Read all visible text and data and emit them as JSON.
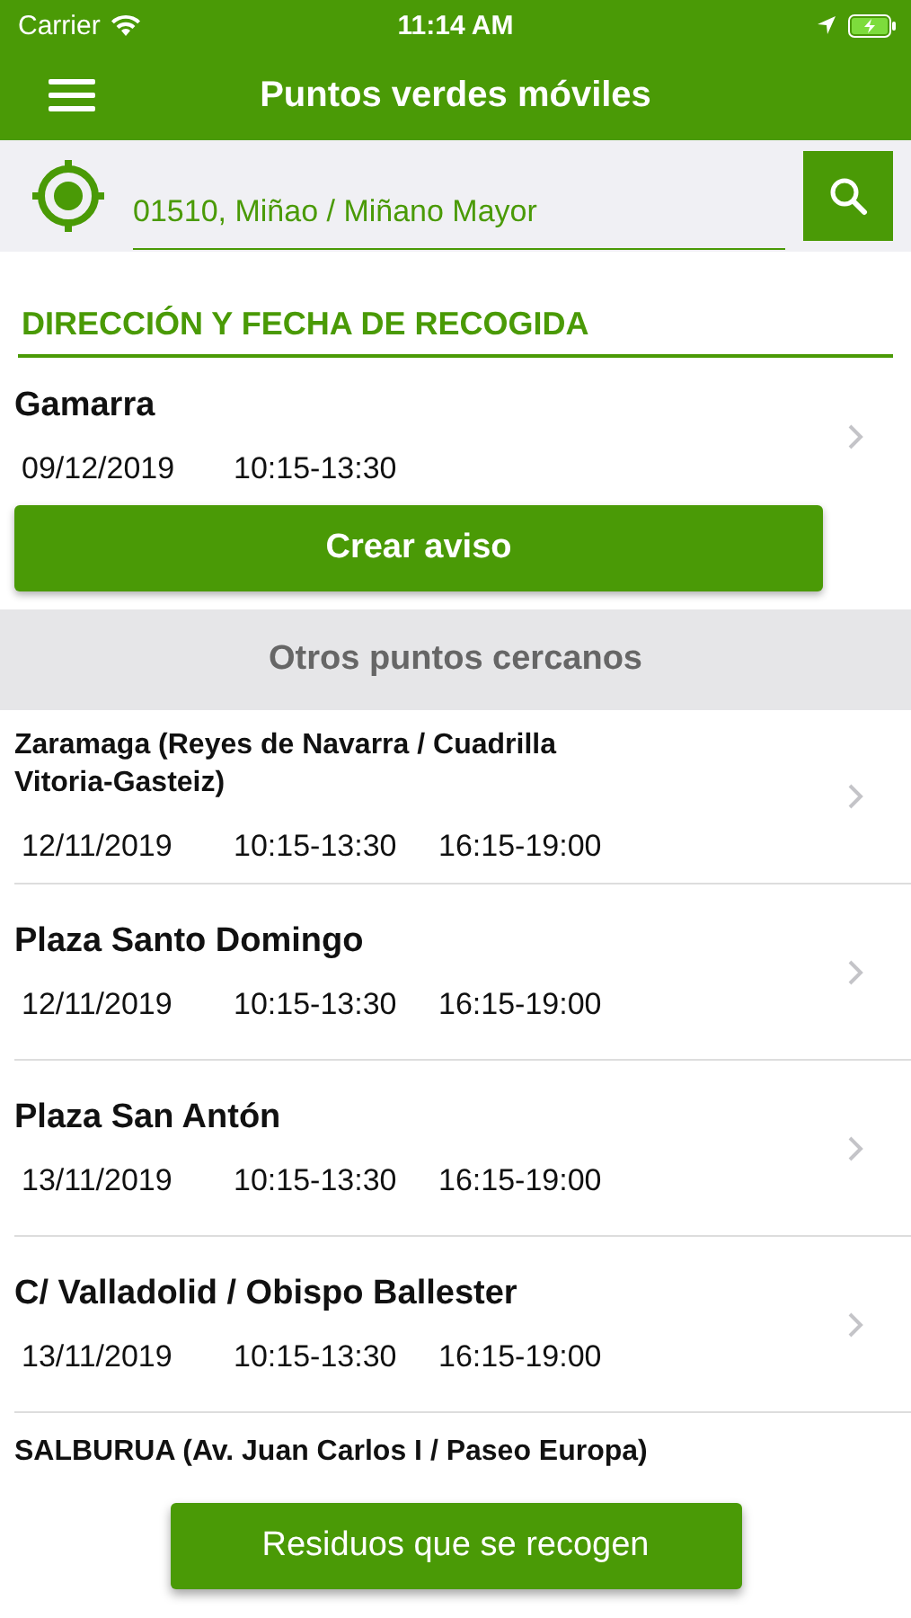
{
  "status_bar": {
    "carrier": "Carrier",
    "time": "11:14 AM"
  },
  "header": {
    "title": "Puntos verdes móviles"
  },
  "search": {
    "value": "01510, Miñao / Miñano Mayor"
  },
  "section_title": "DIRECCIÓN Y FECHA DE RECOGIDA",
  "main_point": {
    "name": "Gamarra",
    "date": "09/12/2019",
    "times": [
      "10:15-13:30"
    ],
    "button": "Crear aviso"
  },
  "nearby_title": "Otros puntos cercanos",
  "nearby": [
    {
      "name": "Zaramaga (Reyes de Navarra / Cuadrilla Vitoria-Gasteiz)",
      "date": "12/11/2019",
      "times": [
        "10:15-13:30",
        "16:15-19:00"
      ]
    },
    {
      "name": "Plaza Santo Domingo",
      "date": "12/11/2019",
      "times": [
        "10:15-13:30",
        "16:15-19:00"
      ]
    },
    {
      "name": "Plaza San Antón",
      "date": "13/11/2019",
      "times": [
        "10:15-13:30",
        "16:15-19:00"
      ]
    },
    {
      "name": "C/ Valladolid / Obispo Ballester",
      "date": "13/11/2019",
      "times": [
        "10:15-13:30",
        "16:15-19:00"
      ]
    },
    {
      "name": "SALBURUA (Av. Juan Carlos I / Paseo Europa)"
    }
  ],
  "bottom_button": "Residuos que se recogen"
}
